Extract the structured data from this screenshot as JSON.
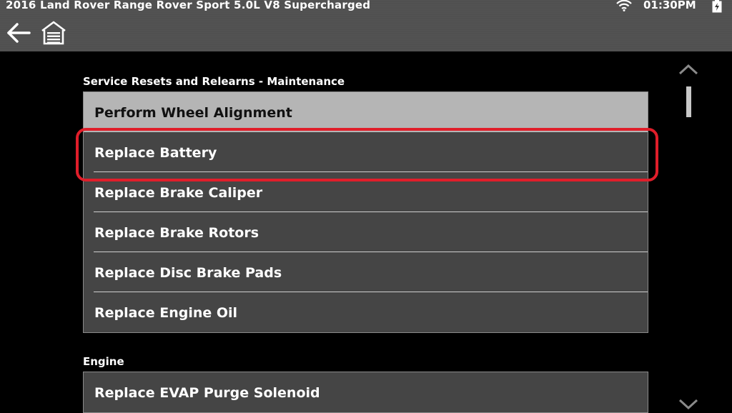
{
  "status_bar": {
    "vehicle_title": "2016 Land Rover Range Rover Sport 5.0L V8 Supercharged",
    "time": "01:30PM"
  },
  "toolbar": {
    "back_icon": "back-arrow-icon",
    "home_icon": "home-garage-icon"
  },
  "sections": [
    {
      "header": "Service Resets and Relearns - Maintenance",
      "items": [
        {
          "label": "Perform Wheel Alignment"
        },
        {
          "label": "Replace Battery"
        },
        {
          "label": "Replace Brake Caliper"
        },
        {
          "label": "Replace Brake Rotors"
        },
        {
          "label": "Replace Disc Brake Pads"
        },
        {
          "label": "Replace Engine Oil"
        }
      ]
    },
    {
      "header": "Engine",
      "items": [
        {
          "label": "Replace EVAP Purge Solenoid"
        }
      ]
    }
  ],
  "colors": {
    "highlight_ring": "#e01e2a",
    "selected_item_bg": "#b5b5b5",
    "item_bg": "#454545"
  }
}
